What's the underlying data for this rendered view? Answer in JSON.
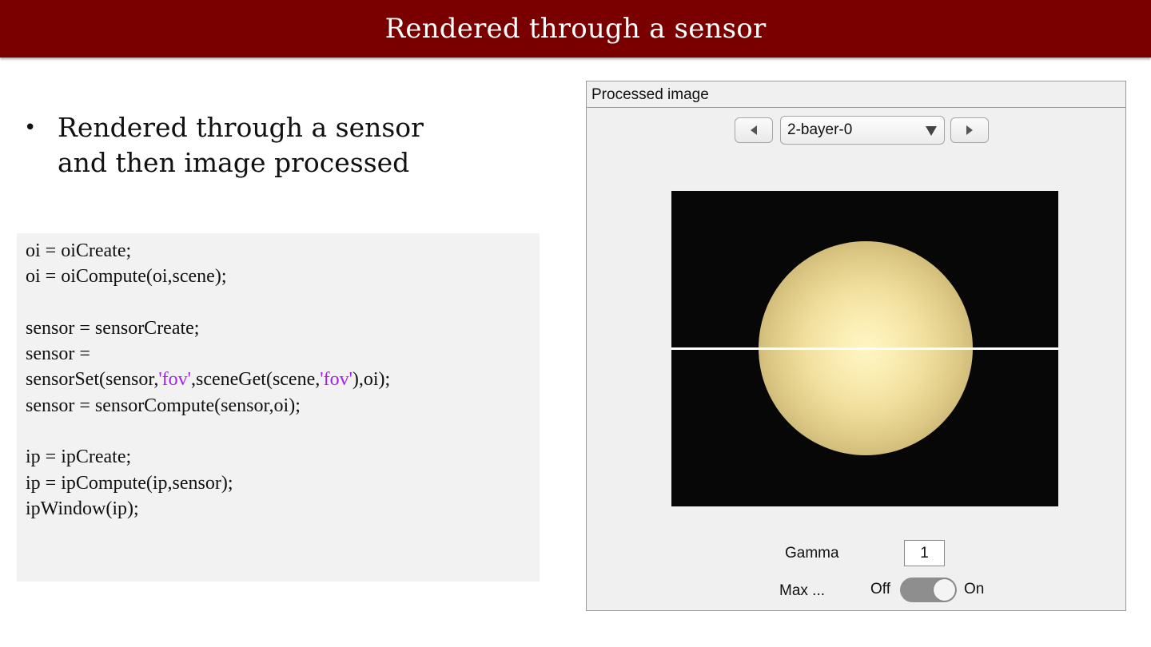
{
  "header": {
    "title": "Rendered through a sensor"
  },
  "bullets": [
    {
      "text": "Rendered through a sensor and then image processed"
    }
  ],
  "code": {
    "lines": [
      [
        {
          "t": "oi = oiCreate;"
        }
      ],
      [
        {
          "t": "oi = oiCompute(oi,scene);"
        }
      ],
      [],
      [
        {
          "t": "sensor = sensorCreate;"
        }
      ],
      [
        {
          "t": "sensor ="
        }
      ],
      [
        {
          "t": "sensorSet(sensor,"
        },
        {
          "t": "'fov'",
          "s": 1
        },
        {
          "t": ",sceneGet(scene,"
        },
        {
          "t": "'fov'",
          "s": 1
        },
        {
          "t": "),oi);"
        }
      ],
      [
        {
          "t": "sensor = sensorCompute(sensor,oi);"
        }
      ],
      [],
      [
        {
          "t": "ip = ipCreate;"
        }
      ],
      [
        {
          "t": "ip = ipCompute(ip,sensor);"
        }
      ],
      [
        {
          "t": "ipWindow(ip);"
        }
      ]
    ],
    "string_color": "#a020f0"
  },
  "panel": {
    "title": "Processed image",
    "selector_value": "2-bayer-0",
    "gamma_label": "Gamma",
    "gamma_value": "1",
    "max_label": "Max ...",
    "toggle_off_label": "Off",
    "toggle_on_label": "On",
    "toggle_state": "on"
  },
  "colors": {
    "header_bg": "#7a0000",
    "code_bg": "#f2f2f2",
    "panel_bg": "#f0f0f0"
  }
}
